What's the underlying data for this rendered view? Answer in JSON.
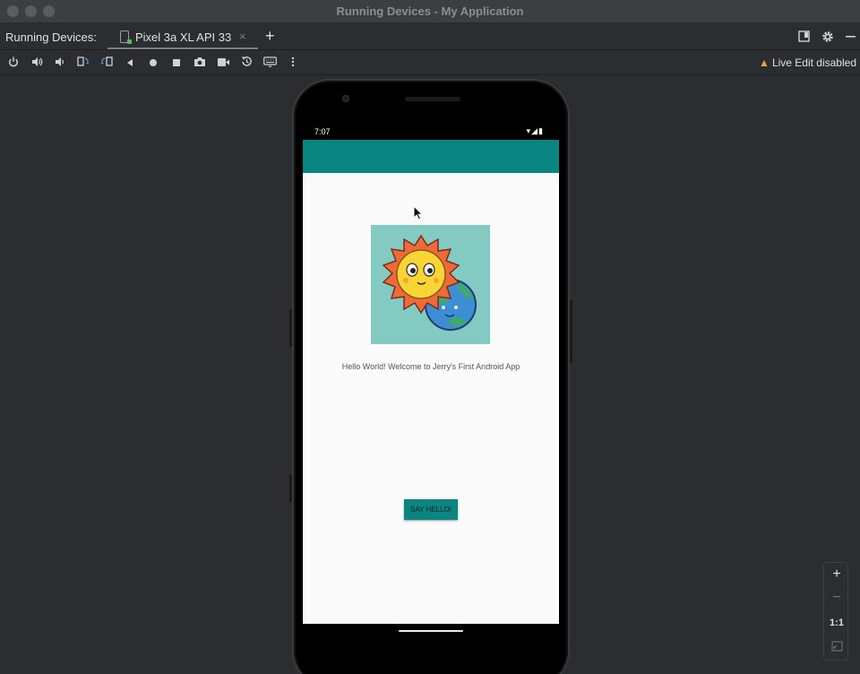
{
  "window": {
    "title": "Running Devices - My Application"
  },
  "tabbar": {
    "label": "Running Devices:",
    "tab_label": "Pixel 3a XL API 33",
    "close": "×",
    "add": "+"
  },
  "toolbar": {
    "icons": [
      "power-icon",
      "volume-up-icon",
      "volume-down-icon",
      "rotate-left-icon",
      "rotate-right-icon",
      "back-icon",
      "home-icon",
      "overview-icon",
      "screenshot-icon",
      "screen-record-icon",
      "reset-icon",
      "keyboard-icon",
      "more-icon"
    ],
    "live_edit": "Live Edit disabled"
  },
  "device": {
    "status_time": "7:07",
    "status_icons": "▾◢▮",
    "hello_text": "Hello World! Welcome to Jerry's First Android App",
    "button_label": "SAY HELLO!",
    "colors": {
      "app_bar": "#0b8582",
      "image_bg": "#83cbc2",
      "screen_bg": "#fafafa"
    }
  },
  "zoom": {
    "in": "+",
    "out": "−",
    "actual": "1:1"
  }
}
